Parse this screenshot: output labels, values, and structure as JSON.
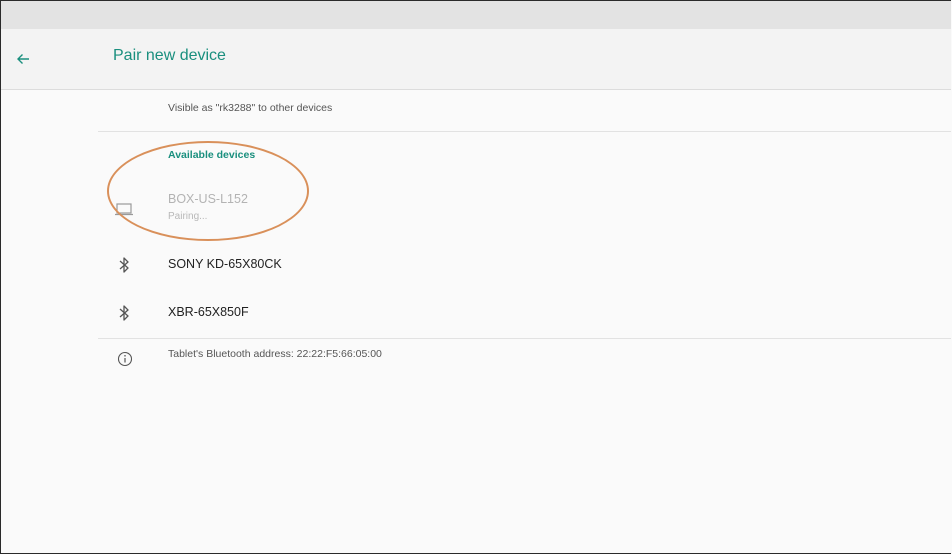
{
  "header": {
    "title": "Pair new device",
    "back_icon": "arrow-back-icon"
  },
  "visible_as": "Visible as \"rk3288\" to other devices",
  "available_section": {
    "title": "Available devices"
  },
  "devices": [
    {
      "name": "BOX-US-L152",
      "status": "Pairing...",
      "icon": "laptop-icon",
      "state": "pairing"
    },
    {
      "name": "SONY KD-65X80CK",
      "icon": "bluetooth-icon"
    },
    {
      "name": "XBR-65X850F",
      "icon": "bluetooth-icon"
    }
  ],
  "bluetooth_address": "Tablet's Bluetooth address: 22:22:F5:66:05:00",
  "colors": {
    "accent": "#1a8f7e",
    "annotation": "#d9905a"
  }
}
